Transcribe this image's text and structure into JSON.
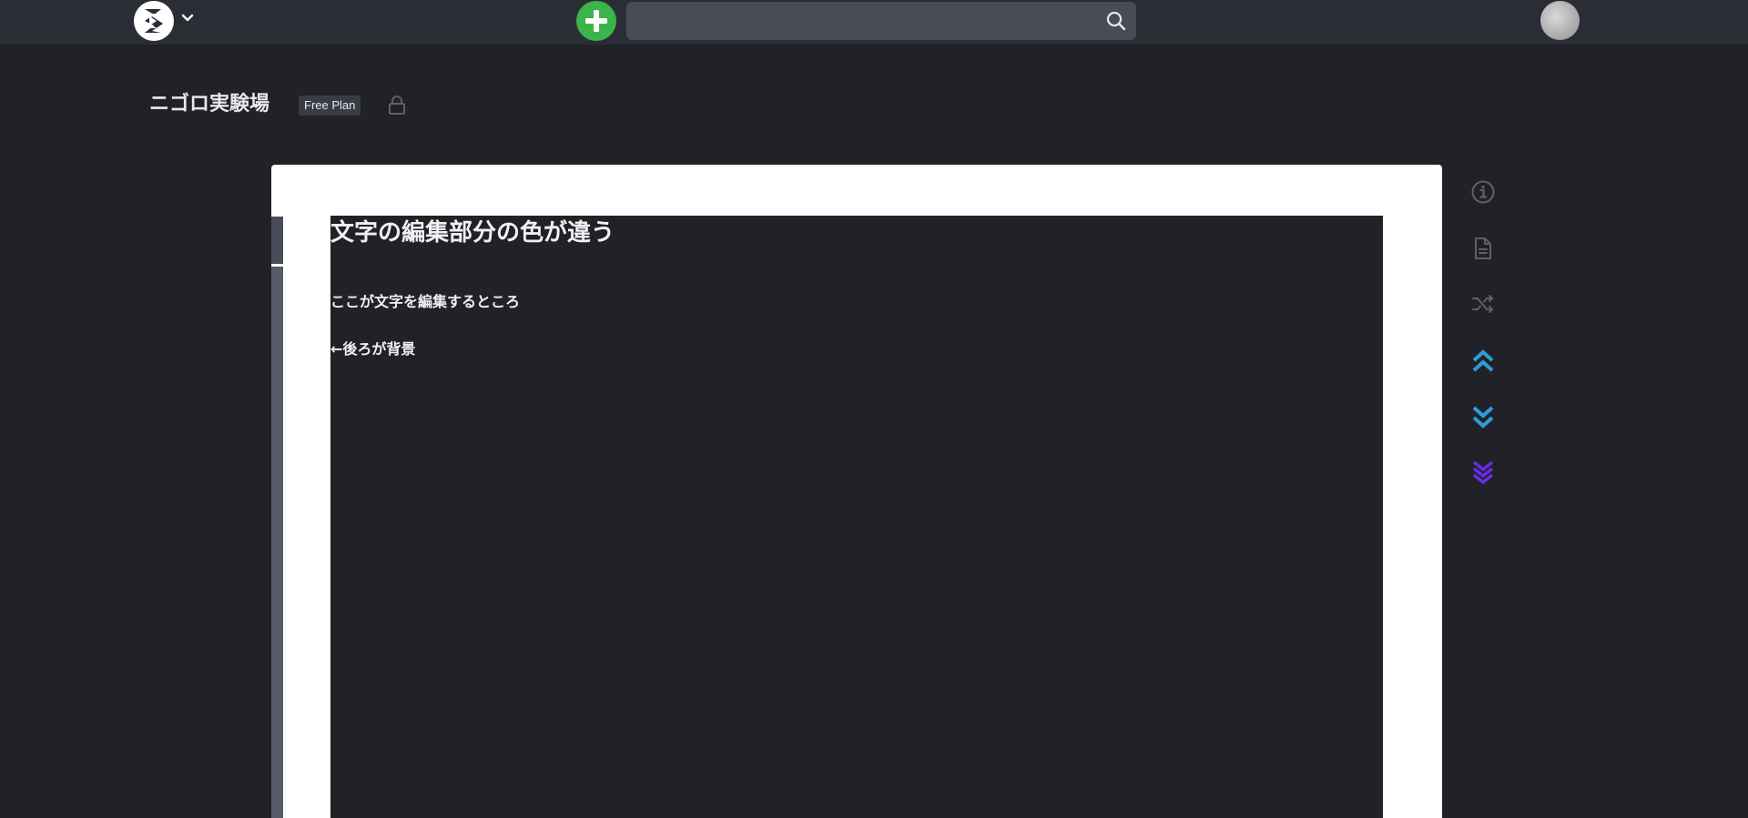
{
  "header": {
    "logo_icon": "scrapbox-logo-icon",
    "logo_menu_icon": "chevron-down-icon",
    "add_icon": "plus-circle-icon",
    "search": {
      "value": "",
      "placeholder": "",
      "icon": "search-icon"
    },
    "avatar_icon": "user-avatar"
  },
  "project": {
    "name": "ニゴロ実験場",
    "plan": "Free Plan",
    "lock_icon": "lock-icon"
  },
  "page": {
    "title": "文字の編集部分の色が違う",
    "lines": [
      "ここが文字を編集するところ",
      "←後ろが背景"
    ]
  },
  "side_tools": [
    {
      "icon": "info-icon",
      "color": "#5f6068"
    },
    {
      "icon": "page-icon",
      "color": "#5f6068"
    },
    {
      "icon": "shuffle-icon",
      "color": "#5f6068"
    },
    {
      "icon": "scroll-to-top-icon",
      "color": "#2d9cdb"
    },
    {
      "icon": "scroll-to-bottom-icon",
      "color": "#2d9cdb"
    },
    {
      "icon": "scroll-to-bottom-deep-icon",
      "color": "#6a2ae8"
    }
  ],
  "colors": {
    "topbar": "#2b2d35",
    "background": "#212227",
    "editor_background": "#212227",
    "add_button": "#3cb44b",
    "page_card": "#ffffff"
  }
}
